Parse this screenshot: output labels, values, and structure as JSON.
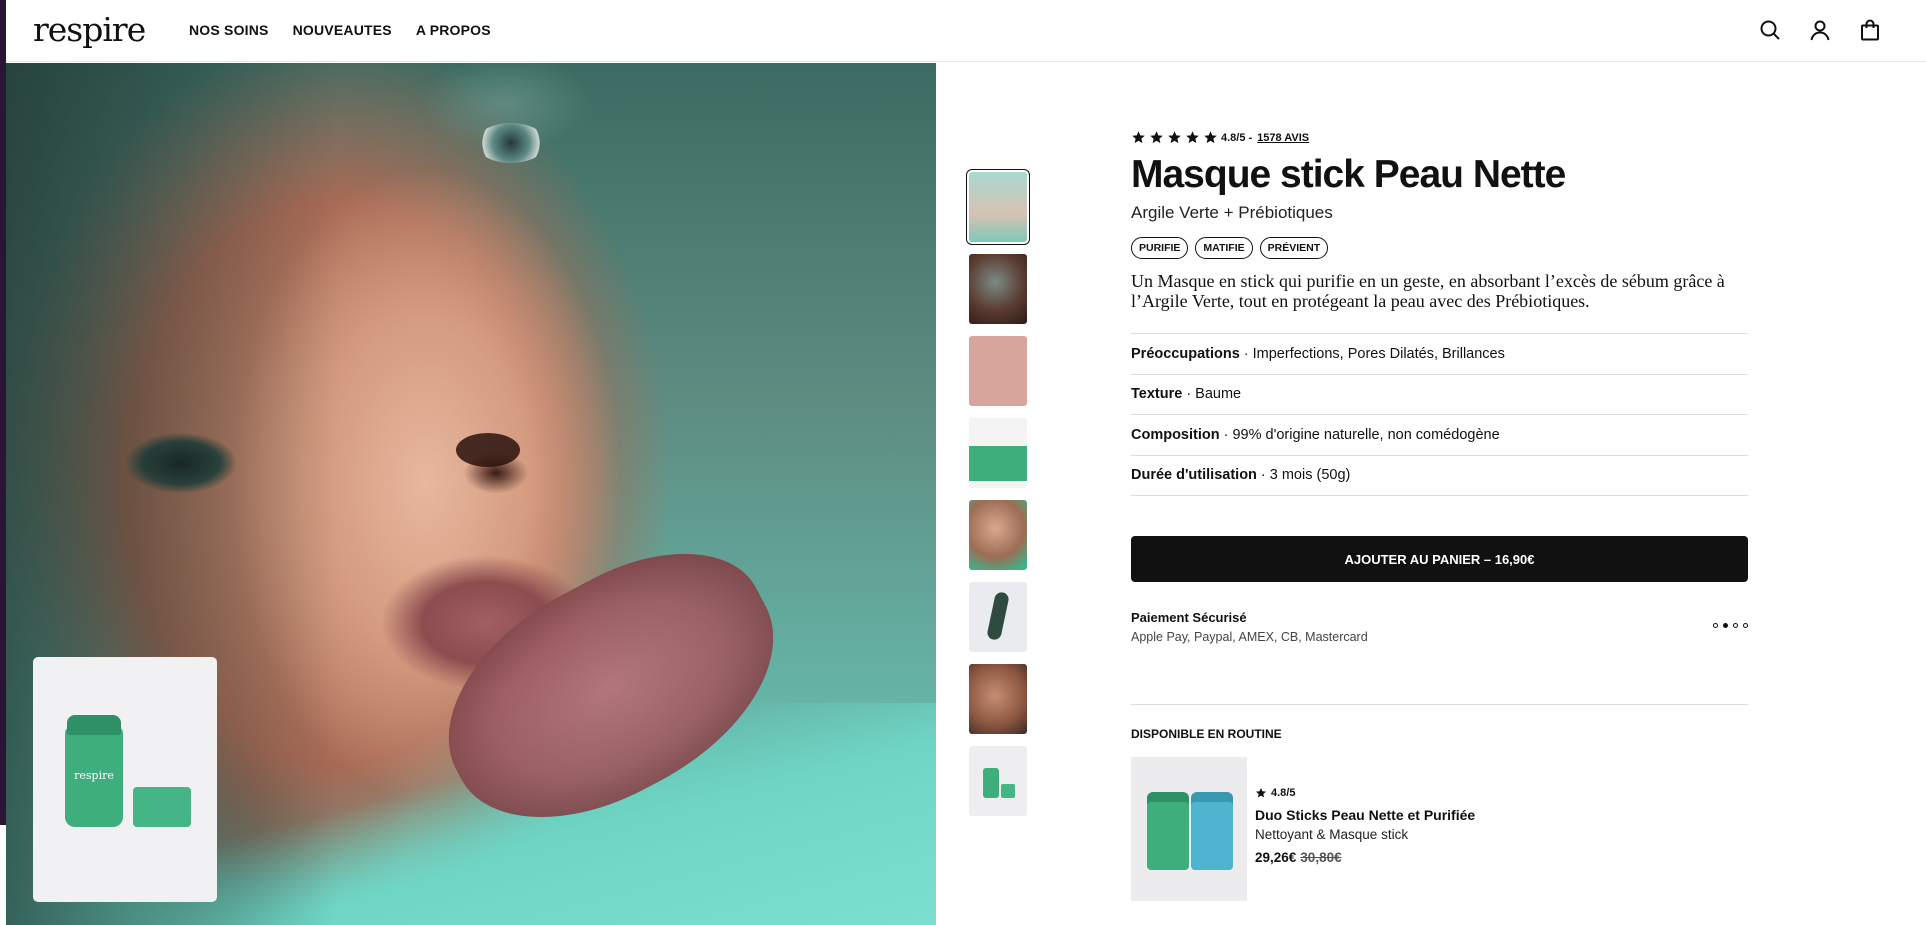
{
  "header": {
    "logo": "respire",
    "nav": [
      "NOS SOINS",
      "NOUVEAUTES",
      "A PROPOS"
    ]
  },
  "hero": {
    "inset_brand": "respire"
  },
  "product": {
    "rating": "4.8/5",
    "rating_sep": "-",
    "reviews": "1578 AVIS",
    "title": "Masque stick Peau Nette",
    "subtitle": "Argile Verte + Prébiotiques",
    "tags": [
      "PURIFIE",
      "MATIFIE",
      "PRÉVIENT"
    ],
    "description": "Un Masque en stick qui purifie en un geste, en absorbant l’excès de sébum grâce à l’Argile Verte, tout en protégeant la peau avec des Prébiotiques.",
    "specs": [
      {
        "label": "Préoccupations",
        "value": "Imperfections, Pores Dilatés, Brillances"
      },
      {
        "label": "Texture",
        "value": "Baume"
      },
      {
        "label": "Composition",
        "value": "99% d'origine naturelle, non comédogène"
      },
      {
        "label": "Durée d'utilisation",
        "value": "3 mois (50g)"
      }
    ],
    "spec_separator": "·",
    "cta": "AJOUTER AU PANIER – 16,90€"
  },
  "payment": {
    "title": "Paiement Sécurisé",
    "methods": "Apple Pay, Paypal, AMEX, CB, Mastercard"
  },
  "routine": {
    "heading": "DISPONIBLE EN ROUTINE",
    "rating": "4.8/5",
    "name": "Duo Sticks Peau Nette et Purifiée",
    "subtitle": "Nettoyant & Masque stick",
    "price": "29,26€",
    "old_price": "30,80€"
  },
  "colors": {
    "accent_green": "#3fae7d",
    "cta_background": "#111111"
  }
}
